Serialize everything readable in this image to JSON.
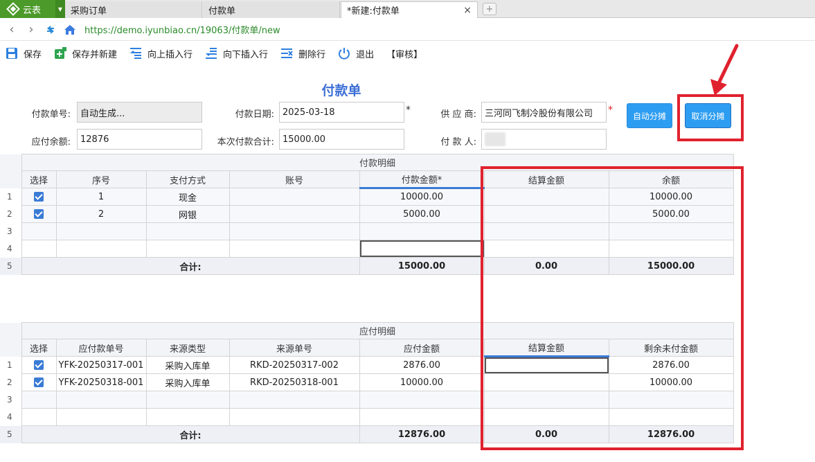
{
  "browser": {
    "brand": "云表",
    "tabs": [
      {
        "label": "采购订单"
      },
      {
        "label": "付款单"
      },
      {
        "label": "*新建:付款单",
        "close": "×"
      }
    ],
    "new_tab": "+",
    "url": "https://demo.iyunbiao.cn/19063/付款单/new"
  },
  "toolbar": {
    "items": [
      "保存",
      "保存并新建",
      "向上插入行",
      "向下插入行",
      "删除行",
      "退出",
      "【审核】"
    ]
  },
  "form": {
    "title": "付款单",
    "payment_no_label": "付款单号:",
    "payment_no_value": "自动生成...",
    "payment_date_label": "付款日期:",
    "payment_date_value": "2025-03-18",
    "supplier_label": "供 应 商:",
    "supplier_value": "三河同飞制冷股份有限公司",
    "payable_balance_label": "应付余额:",
    "payable_balance_value": "12876",
    "this_payment_total_label": "本次付款合计:",
    "this_payment_total_value": "15000.00",
    "payer_label": "付 款 人:",
    "required_mark": "*",
    "auto_allocate_button": "自动分摊",
    "cancel_allocate_button": "取消分摊"
  },
  "payment_detail": {
    "section_title": "付款明细",
    "columns": [
      "选择",
      "序号",
      "支付方式",
      "账号",
      "付款金额*",
      "结算金额",
      "余额"
    ],
    "row_numbers": [
      "1",
      "2",
      "3",
      "4",
      "5"
    ],
    "rows": [
      {
        "seq": "1",
        "method": "现金",
        "account": "",
        "amount": "10000.00",
        "settled": "",
        "balance": "10000.00"
      },
      {
        "seq": "2",
        "method": "网银",
        "account": "",
        "amount": "5000.00",
        "settled": "",
        "balance": "5000.00"
      }
    ],
    "total_label": "合计:",
    "total_amount": "15000.00",
    "total_settled": "0.00",
    "total_balance": "15000.00"
  },
  "payable_detail": {
    "section_title": "应付明细",
    "columns": [
      "选择",
      "应付款单号",
      "来源类型",
      "来源单号",
      "应付金额",
      "结算金额",
      "剩余未付金额"
    ],
    "row_numbers": [
      "1",
      "2",
      "3",
      "4",
      "5"
    ],
    "rows": [
      {
        "payable_no": "YFK-20250317-001",
        "source_type": "采购入库单",
        "source_no": "RKD-20250317-002",
        "payable_amount": "2876.00",
        "settled": "",
        "remaining": "2876.00"
      },
      {
        "payable_no": "YFK-20250318-001",
        "source_type": "采购入库单",
        "source_no": "RKD-20250318-001",
        "payable_amount": "10000.00",
        "settled": "",
        "remaining": "10000.00"
      }
    ],
    "total_label": "合计:",
    "total_payable": "12876.00",
    "total_settled": "0.00",
    "total_remaining": "12876.00"
  },
  "annotation_color": "#e0222e"
}
